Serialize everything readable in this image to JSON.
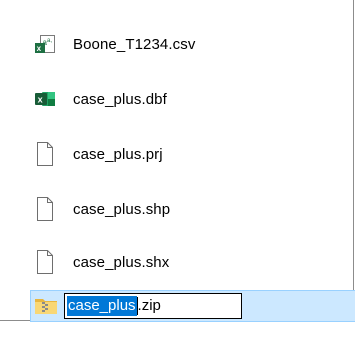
{
  "files": [
    {
      "name": "Boone_T1234.csv",
      "icon": "csv-excel-icon"
    },
    {
      "name": "case_plus.dbf",
      "icon": "excel-icon"
    },
    {
      "name": "case_plus.prj",
      "icon": "blank-file-icon"
    },
    {
      "name": "case_plus.shp",
      "icon": "blank-file-icon"
    },
    {
      "name": "case_plus.shx",
      "icon": "blank-file-icon"
    }
  ],
  "rename": {
    "icon": "zip-folder-icon",
    "selected_text": "case_plus",
    "remaining_text": ".zip"
  },
  "colors": {
    "selection_row": "#cce8ff",
    "selection_border": "#99d1ff",
    "text_highlight": "#0078d7",
    "excel_green": "#1d6f42"
  }
}
